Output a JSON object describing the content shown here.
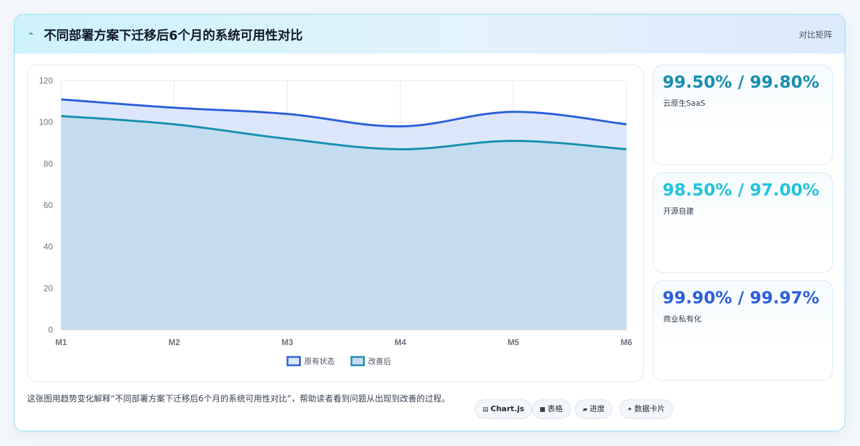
{
  "header": {
    "icon": "trend-icon",
    "title": "不同部署方案下迁移后6个月的系统可用性对比",
    "action_label": "对比矩阵"
  },
  "chart_data": {
    "type": "area",
    "categories": [
      "M1",
      "M2",
      "M3",
      "M4",
      "M5",
      "M6"
    ],
    "series": [
      {
        "name": "原有状态",
        "values": [
          111,
          107,
          104,
          98,
          105,
          99
        ],
        "color": "#2b5fd9",
        "fill": "#dde7fb"
      },
      {
        "name": "改善后",
        "values": [
          103,
          99,
          92,
          87,
          91,
          87
        ],
        "color": "#178fb0",
        "fill": "#c4dcf0"
      }
    ],
    "ylim": [
      0,
      120
    ],
    "yticks": [
      0,
      20,
      40,
      60,
      80,
      100,
      120
    ],
    "grid": true,
    "legend": "bottom-center"
  },
  "stats": [
    {
      "value": "99.50% / 99.80%",
      "label": "云原生SaaS",
      "color": "#178fb0"
    },
    {
      "value": "98.50% / 97.00%",
      "label": "开源自建",
      "color": "#22c3dc"
    },
    {
      "value": "99.90% / 99.97%",
      "label": "商业私有化",
      "color": "#2b5fd9"
    }
  ],
  "description": "这张图用趋势变化解释“不同部署方案下迁移后6个月的系统可用性对比”，帮助读者看到问题从出现到改善的过程。",
  "chips": [
    {
      "icon": "chart-icon",
      "glyph": "▤",
      "label": "Chart.js"
    },
    {
      "icon": "table-icon",
      "glyph": "■",
      "label": "表格"
    },
    {
      "icon": "progress-icon",
      "glyph": "▰",
      "label": "进度"
    },
    {
      "icon": "card-icon",
      "glyph": "✦",
      "label": "数据卡片"
    }
  ]
}
